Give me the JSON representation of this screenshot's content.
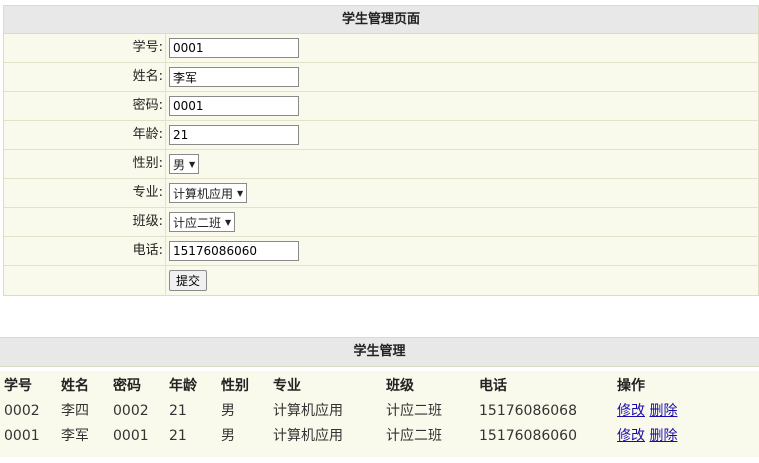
{
  "form": {
    "title": "学生管理页面",
    "fields": {
      "student_id": {
        "label": "学号:",
        "value": "0001"
      },
      "name": {
        "label": "姓名:",
        "value": "李军"
      },
      "password": {
        "label": "密码:",
        "value": "0001"
      },
      "age": {
        "label": "年龄:",
        "value": "21"
      },
      "gender": {
        "label": "性别:",
        "value": "男"
      },
      "major": {
        "label": "专业:",
        "value": "计算机应用"
      },
      "class": {
        "label": "班级:",
        "value": "计应二班"
      },
      "phone": {
        "label": "电话:",
        "value": "15176086060"
      }
    },
    "submit_label": "提交"
  },
  "table": {
    "title": "学生管理",
    "headers": [
      "学号",
      "姓名",
      "密码",
      "年龄",
      "性别",
      "专业",
      "班级",
      "电话",
      "操作"
    ],
    "rows": [
      [
        "0002",
        "李四",
        "0002",
        "21",
        "男",
        "计算机应用",
        "计应二班",
        "15176086068"
      ],
      [
        "0001",
        "李军",
        "0001",
        "21",
        "男",
        "计算机应用",
        "计应二班",
        "15176086060"
      ]
    ],
    "edit_label": "修改",
    "delete_label": "删除"
  },
  "icons": {
    "select_caret": "caret-down-icon"
  }
}
